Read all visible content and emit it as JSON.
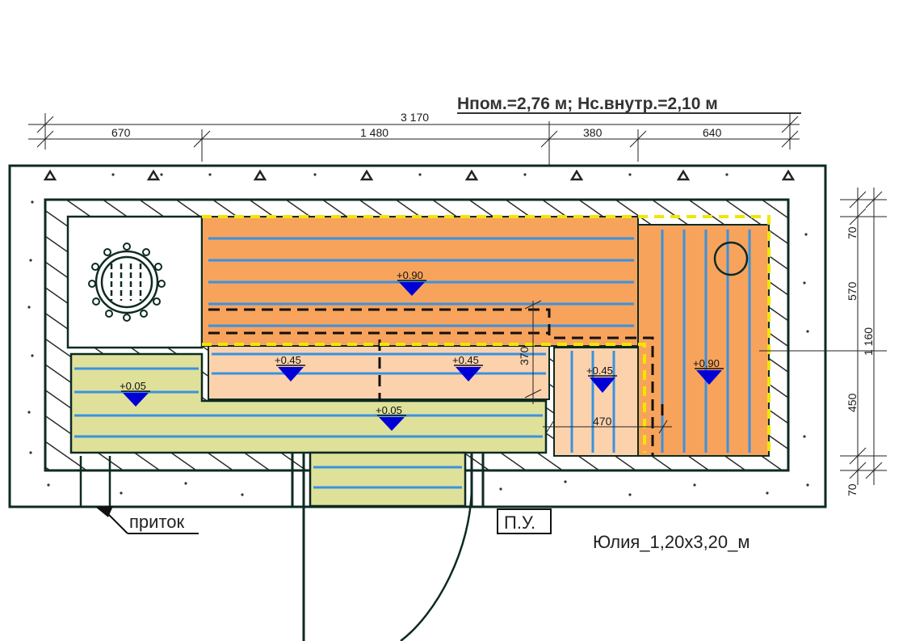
{
  "header": {
    "text": "Нпом.=2,76 м; Нс.внутр.=2,10 м"
  },
  "dimensions": {
    "top": [
      "670",
      "1 480",
      "380",
      "640"
    ],
    "total": "3 170",
    "right": [
      "70",
      "570",
      "450",
      "70"
    ],
    "right_total": "1 160",
    "inner_vertical": "370",
    "inner_horizontal": "470"
  },
  "levels": [
    "+0.90",
    "+0.45",
    "+0.45",
    "+0.45",
    "+0.90",
    "+0.05",
    "+0.05"
  ],
  "labels": {
    "intake": "приток",
    "control": "П.У.",
    "model": "Юлия_1,20х3,20_м"
  },
  "colors": {
    "wall_line": "#0d2a22",
    "bench_top": "#f7a35c",
    "bench_mid": "#fcd2ad",
    "floor": "#dfe19a",
    "slats": "#3a92e0",
    "marker": "#0000d6",
    "foil": "#f2e600"
  }
}
